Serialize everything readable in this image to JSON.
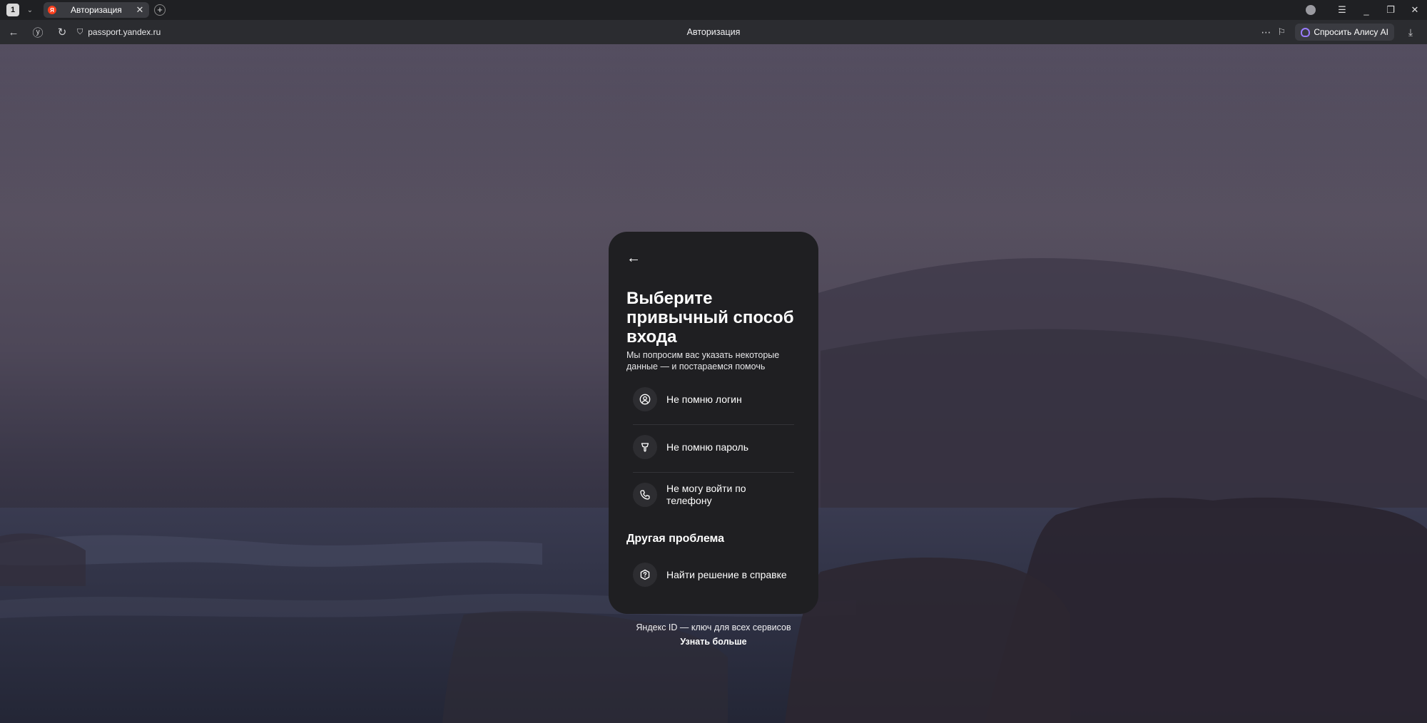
{
  "browser": {
    "tab_count": "1",
    "tab_title": "Авторизация",
    "favicon_letter": "Я",
    "url": "passport.yandex.ru",
    "page_title": "Авторизация",
    "alice_button": "Спросить Алису AI"
  },
  "card": {
    "title": "Выберите привычный способ входа",
    "subtitle": "Мы попросим вас указать некоторые данные — и постараемся помочь",
    "options": [
      {
        "label": "Не помню логин",
        "icon": "user-circle-icon"
      },
      {
        "label": "Не помню пароль",
        "icon": "key-icon"
      },
      {
        "label": "Не могу войти по телефону",
        "icon": "phone-icon"
      }
    ],
    "other_section_title": "Другая проблема",
    "help_option": {
      "label": "Найти решение в справке",
      "icon": "question-icon"
    }
  },
  "footer": {
    "text": "Яндекс ID — ключ для всех сервисов",
    "link": "Узнать больше"
  },
  "colors": {
    "card_bg": "#1f1f22",
    "alice_accent": "#9a7cff",
    "yandex_red": "#fc3f1d"
  }
}
